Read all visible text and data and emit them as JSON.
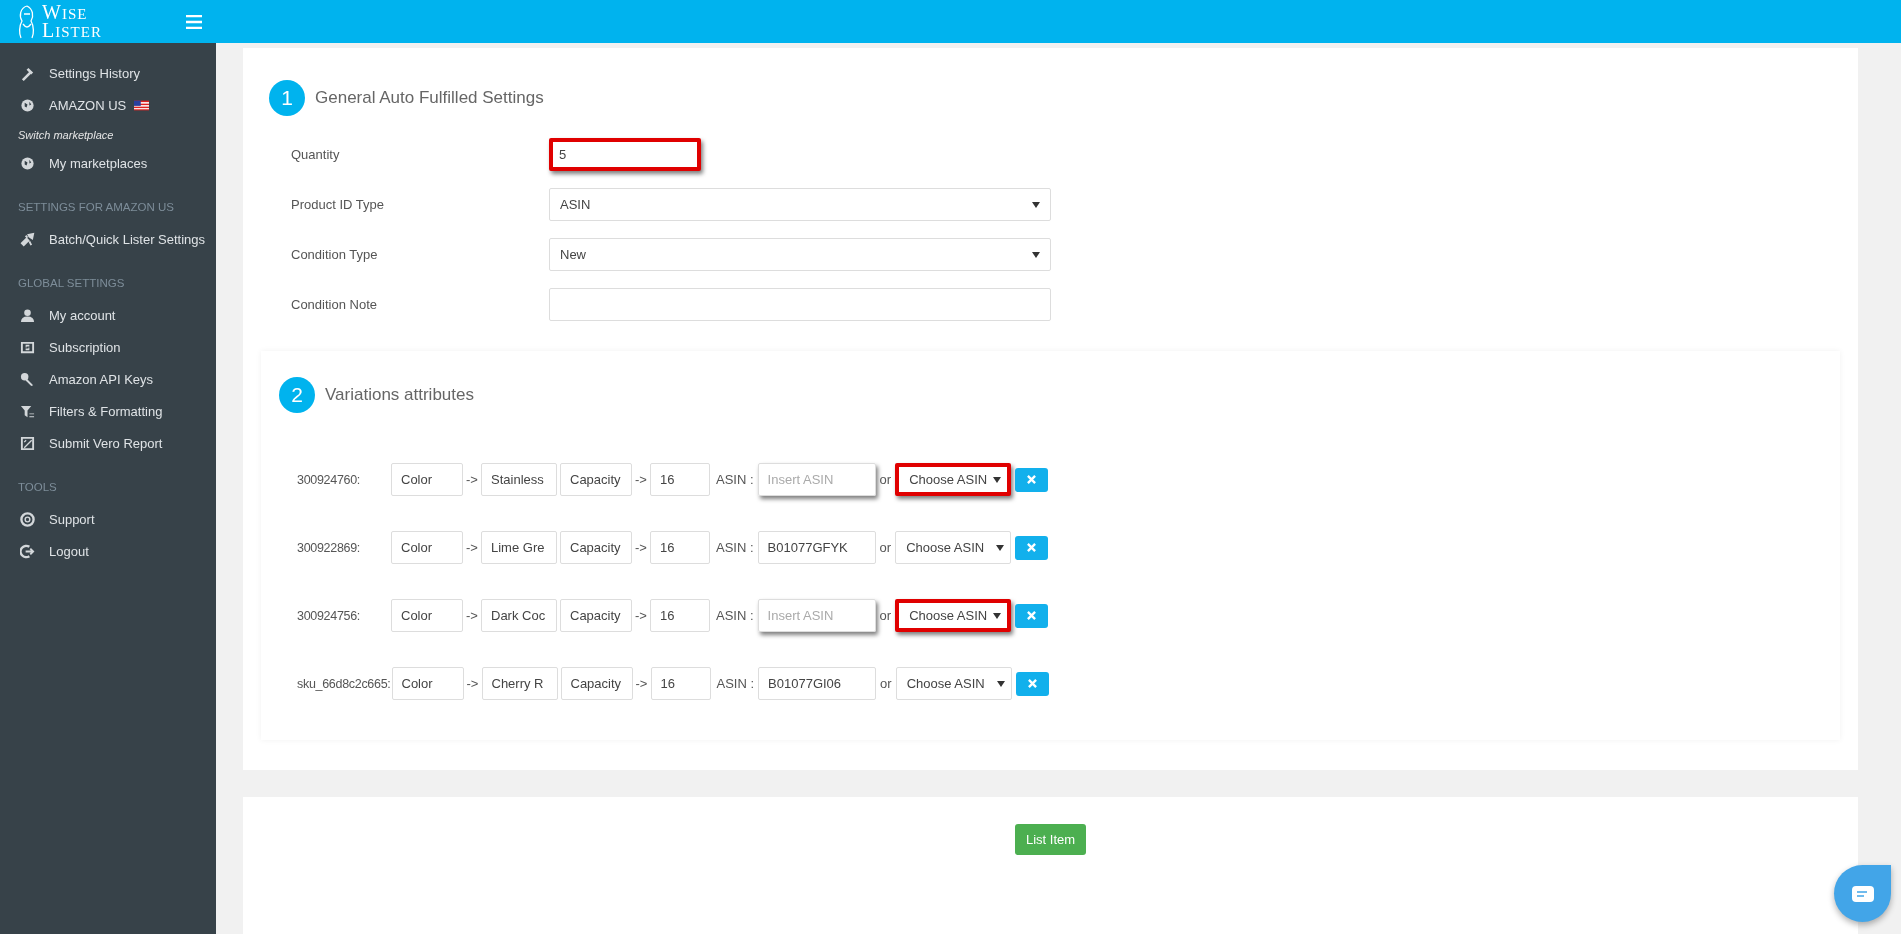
{
  "header": {
    "logo": [
      "WISE",
      "LISTER"
    ]
  },
  "sidebar": {
    "items": [
      {
        "kind": "item",
        "label": "Settings History"
      },
      {
        "kind": "item",
        "label": "AMAZON US",
        "flag": true
      },
      {
        "kind": "note",
        "label": "Switch marketplace"
      },
      {
        "kind": "item",
        "label": "My marketplaces"
      },
      {
        "kind": "section",
        "label": "SETTINGS FOR AMAZON US"
      },
      {
        "kind": "item",
        "label": "Batch/Quick Lister Settings"
      },
      {
        "kind": "section",
        "label": "GLOBAL SETTINGS"
      },
      {
        "kind": "item",
        "label": "My account"
      },
      {
        "kind": "item",
        "label": "Subscription"
      },
      {
        "kind": "item",
        "label": "Amazon API Keys"
      },
      {
        "kind": "item",
        "label": "Filters & Formatting"
      },
      {
        "kind": "item",
        "label": "Submit Vero Report"
      },
      {
        "kind": "section",
        "label": "TOOLS"
      },
      {
        "kind": "item",
        "label": "Support"
      },
      {
        "kind": "item",
        "label": "Logout"
      }
    ]
  },
  "general": {
    "number": "1",
    "title": "General Auto Fulfilled Settings",
    "fields": [
      {
        "kind": "input",
        "label": "Quantity",
        "value": "5",
        "highlighted": true
      },
      {
        "kind": "select",
        "label": "Product ID Type",
        "value": "ASIN",
        "highlighted": false
      },
      {
        "kind": "select",
        "label": "Condition Type",
        "value": "New",
        "highlighted": false
      },
      {
        "kind": "input",
        "label": "Condition Note",
        "highlighted": false
      }
    ]
  },
  "variations": {
    "number": "2",
    "title": "Variations attributes",
    "rows": [
      {
        "sku": "300924760:",
        "attr_1": "Color",
        "arrow_1": "->",
        "value_1": "Stainless",
        "attr_2": "Capacity",
        "arrow_2": "->",
        "value_2": "16",
        "asin_label": "ASIN :",
        "asin_placeholder": "Insert ASIN",
        "asin_highlighted": true,
        "or_label": "or",
        "choose": "Choose ASIN",
        "choose_highlighted": true
      },
      {
        "sku": "300922869:",
        "attr_1": "Color",
        "arrow_1": "->",
        "value_1": "Lime Gre",
        "attr_2": "Capacity",
        "arrow_2": "->",
        "value_2": "16",
        "asin_label": "ASIN :",
        "asin_value": "B01077GFYK",
        "asin_highlighted": false,
        "or_label": "or",
        "choose": "Choose ASIN",
        "choose_highlighted": false
      },
      {
        "sku": "300924756:",
        "attr_1": "Color",
        "arrow_1": "->",
        "value_1": "Dark Coc",
        "attr_2": "Capacity",
        "arrow_2": "->",
        "value_2": "16",
        "asin_label": "ASIN :",
        "asin_placeholder": "Insert ASIN",
        "asin_highlighted": true,
        "or_label": "or",
        "choose": "Choose ASIN",
        "choose_highlighted": true
      },
      {
        "sku": "sku_66d8c2c665:",
        "attr_1": "Color",
        "arrow_1": "->",
        "value_1": "Cherry R",
        "attr_2": "Capacity",
        "arrow_2": "->",
        "value_2": "16",
        "asin_label": "ASIN :",
        "asin_value": "B01077GI06",
        "asin_highlighted": false,
        "or_label": "or",
        "choose": "Choose ASIN",
        "choose_highlighted": false
      }
    ]
  },
  "submit": {
    "label": "List Item"
  }
}
